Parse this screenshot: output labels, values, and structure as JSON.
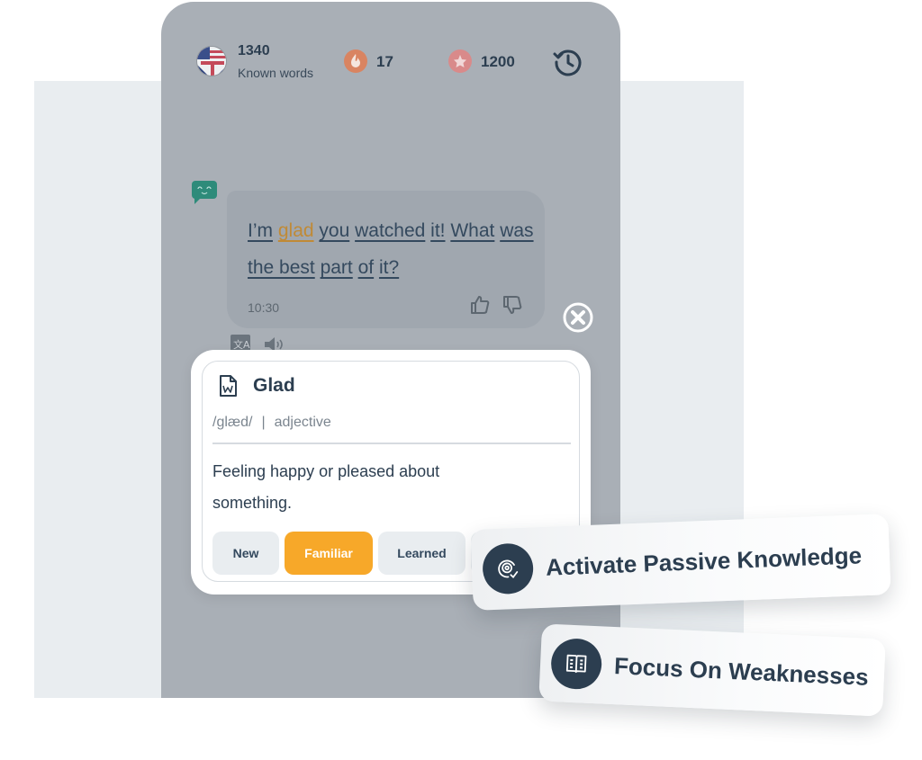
{
  "header": {
    "known_words_count": "1340",
    "known_words_label": "Known words",
    "streak_count": "17",
    "points": "1200",
    "icons": {
      "language": "us-uk-flag-icon",
      "streak": "flame-icon",
      "points": "star-icon",
      "history": "history-clock-icon"
    }
  },
  "message": {
    "words": [
      {
        "text": "I’m",
        "highlight": false
      },
      {
        "text": "glad",
        "highlight": true
      },
      {
        "text": "you",
        "highlight": false
      },
      {
        "text": "watched",
        "highlight": false
      },
      {
        "text": "it!",
        "highlight": false
      },
      {
        "text": "What",
        "highlight": false
      },
      {
        "text": "was",
        "highlight": false
      },
      {
        "text": "the best",
        "highlight": false
      },
      {
        "text": "part",
        "highlight": false
      },
      {
        "text": "of",
        "highlight": false
      },
      {
        "text": "it?",
        "highlight": false
      }
    ],
    "time": "10:30",
    "icons": {
      "bot": "bot-chat-icon",
      "like": "thumbs-up-icon",
      "dislike": "thumbs-down-icon",
      "translate": "translate-icon",
      "audio": "speaker-icon",
      "close": "close-circle-icon"
    }
  },
  "word_card": {
    "word": "Glad",
    "phonetic": "/glæd/",
    "separator": "|",
    "part_of_speech": "adjective",
    "definition": "Feeling happy or pleased about something.",
    "levels": [
      {
        "label": "New",
        "selected": false
      },
      {
        "label": "Familiar",
        "selected": true
      },
      {
        "label": "Learned",
        "selected": false
      }
    ],
    "selected_color": "#f7a829",
    "highlight_color": "#c08a36"
  },
  "features": [
    {
      "label": "Activate Passive Knowledge",
      "icon": "target-check-icon"
    },
    {
      "label": "Focus On Weaknesses",
      "icon": "open-book-icon"
    }
  ]
}
